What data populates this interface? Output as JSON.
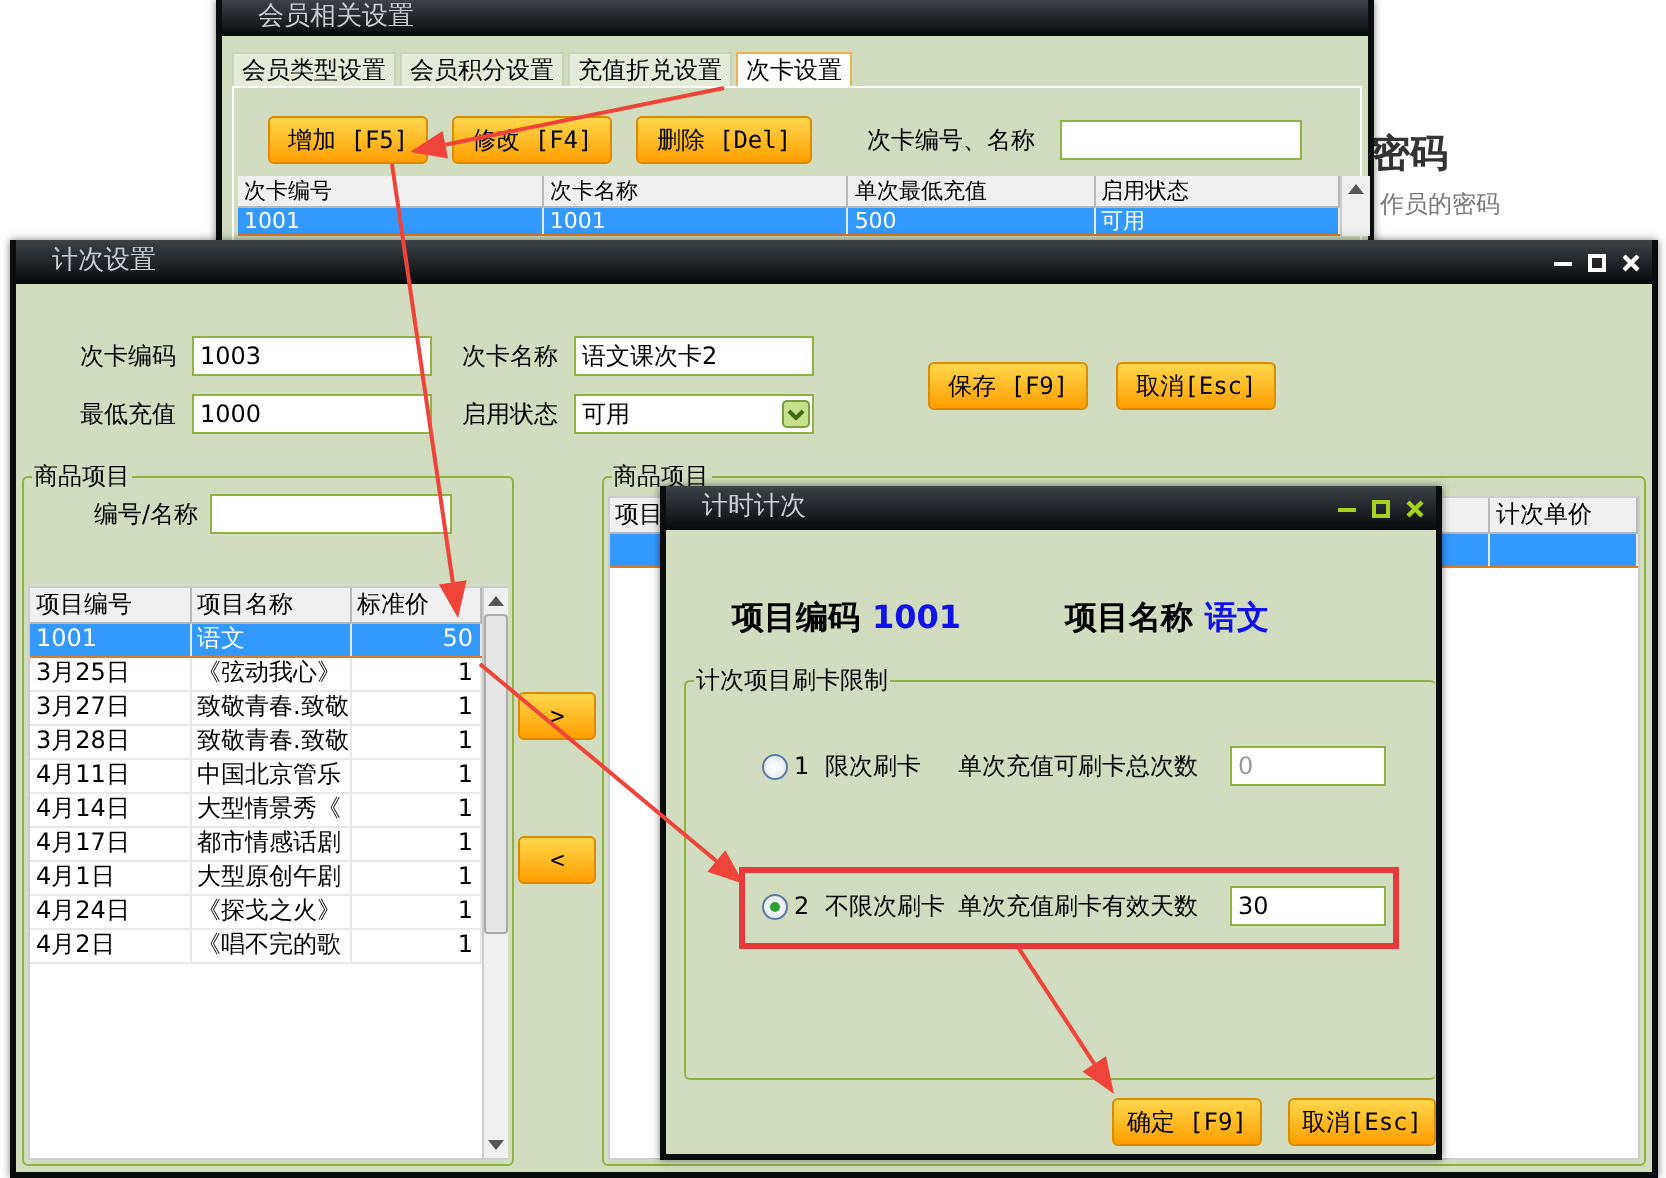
{
  "desktop": {
    "heading": "密码",
    "subtitle": "作员的密码"
  },
  "back_window": {
    "title": "会员相关设置",
    "tabs": [
      {
        "label": "会员类型设置",
        "selected": false
      },
      {
        "label": "会员积分设置",
        "selected": false
      },
      {
        "label": "充值折兑设置",
        "selected": false
      },
      {
        "label": "次卡设置",
        "selected": true
      }
    ],
    "buttons": [
      "增加 [F5]",
      "修改 [F4]",
      "删除 [Del]"
    ],
    "search_label": "次卡编号、名称",
    "table": {
      "columns": [
        "次卡编号",
        "次卡名称",
        "单次最低充值",
        "启用状态"
      ],
      "rows": [
        {
          "cells": [
            "1001",
            "1001",
            "500",
            "可用"
          ],
          "selected": true
        }
      ]
    }
  },
  "card_window": {
    "title": "计次设置",
    "fields": [
      {
        "label": "次卡编码",
        "value": "1003",
        "kind": "text"
      },
      {
        "label": "次卡名称",
        "value": "语文课次卡2",
        "kind": "text"
      },
      {
        "label": "最低充值",
        "value": "1000",
        "kind": "text"
      },
      {
        "label": "启用状态",
        "value": "可用",
        "kind": "select"
      }
    ],
    "buttons": [
      "保存 [F9]",
      "取消[Esc]"
    ],
    "goods_panel": {
      "title": "商品项目",
      "search_label": "编号/名称",
      "table": {
        "columns": [
          "项目编号",
          "项目名称",
          "标准价"
        ],
        "rows": [
          {
            "cells": [
              "1001",
              "语文",
              "50"
            ],
            "selected": true
          },
          {
            "cells": [
              "3月25日",
              "《弦动我心》",
              "1"
            ],
            "selected": false
          },
          {
            "cells": [
              "3月27日",
              "致敬青春.致敬",
              "1"
            ],
            "selected": false
          },
          {
            "cells": [
              "3月28日",
              "致敬青春.致敬",
              "1"
            ],
            "selected": false
          },
          {
            "cells": [
              "4月11日",
              "中国北京管乐",
              "1"
            ],
            "selected": false
          },
          {
            "cells": [
              "4月14日",
              "大型情景秀《",
              "1"
            ],
            "selected": false
          },
          {
            "cells": [
              "4月17日",
              "都市情感话剧",
              "1"
            ],
            "selected": false
          },
          {
            "cells": [
              "4月1日",
              "大型原创午剧",
              "1"
            ],
            "selected": false
          },
          {
            "cells": [
              "4月24日",
              "《探戈之火》",
              "1"
            ],
            "selected": false
          },
          {
            "cells": [
              "4月2日",
              "《唱不完的歌",
              "1"
            ],
            "selected": false
          }
        ]
      }
    },
    "move_buttons": [
      ">",
      "<"
    ],
    "selected_panel": {
      "title": "商品项目",
      "table": {
        "columns": [
          "项目",
          "计次单价"
        ],
        "rows": [
          {
            "selected": true
          }
        ]
      }
    }
  },
  "dialog": {
    "title": "计时计次",
    "code_label": "项目编码",
    "code": "1001",
    "name_label": "项目名称",
    "name": "语文",
    "group_title": "计次项目刷卡限制",
    "options": [
      {
        "label": "1  限次刷卡",
        "field_label": "单次充值可刷卡总次数",
        "value": "0",
        "selected": false,
        "disabled": true
      },
      {
        "label": "2  不限次刷卡",
        "field_label": "单次充值刷卡有效天数",
        "value": "30",
        "selected": true,
        "disabled": false
      }
    ],
    "buttons": [
      "确定 [F9]",
      "取消[Esc]"
    ]
  }
}
